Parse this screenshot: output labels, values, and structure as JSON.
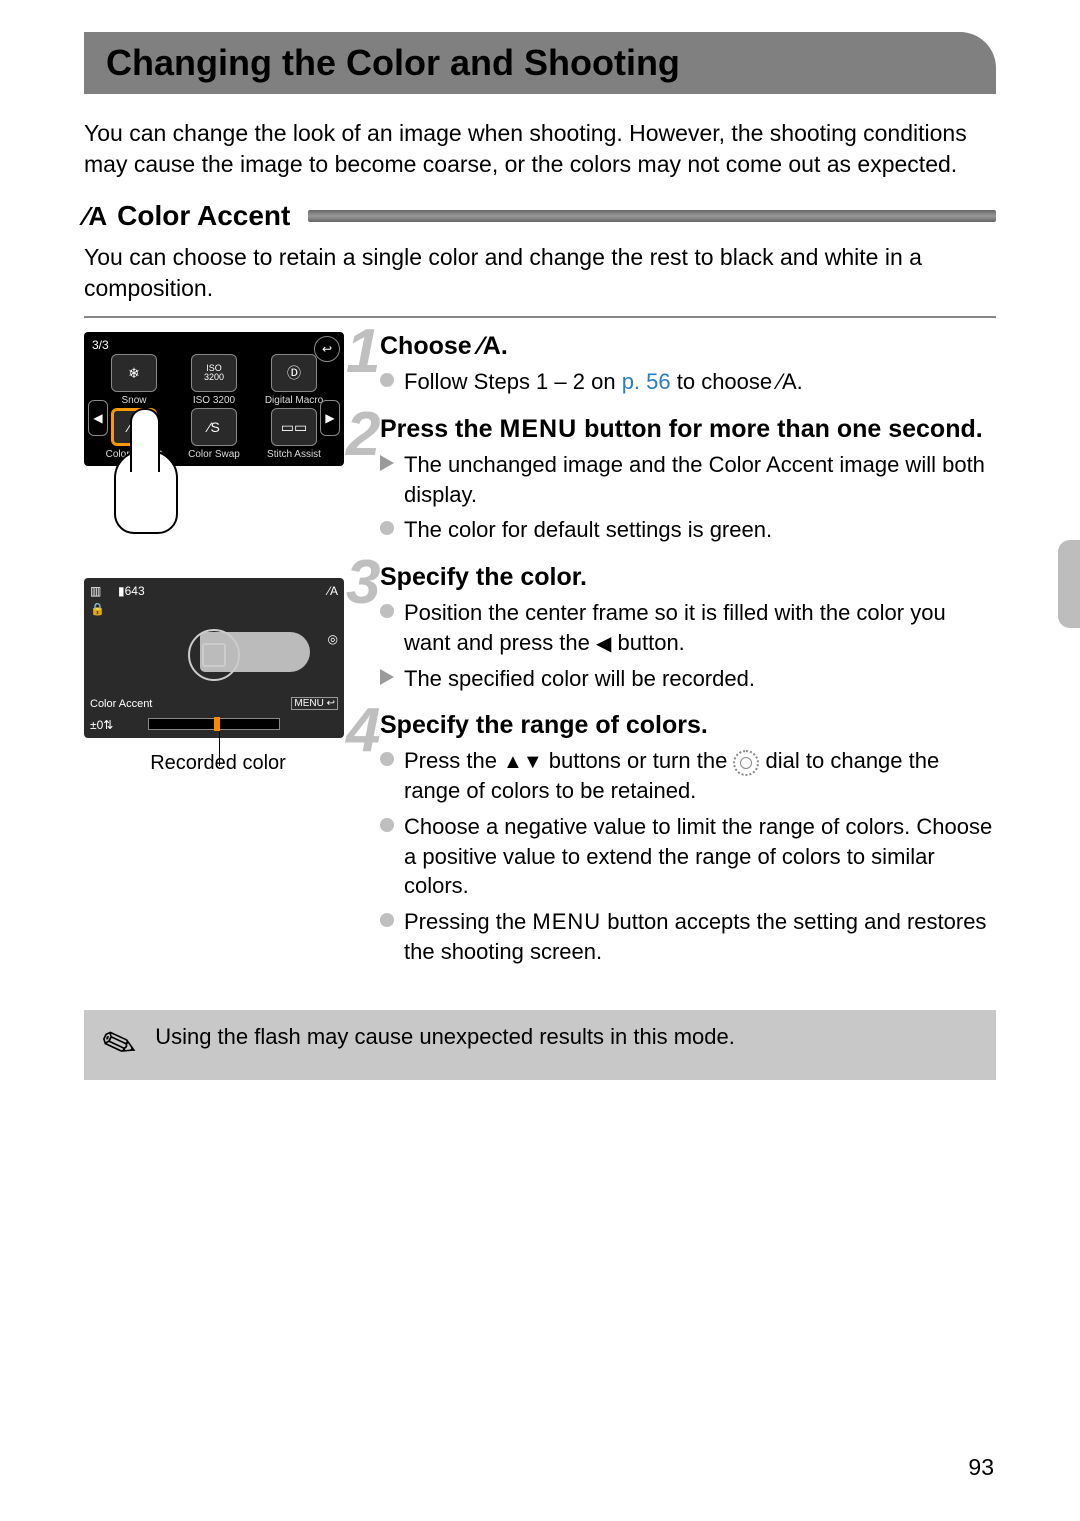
{
  "page": {
    "title": "Changing the Color and Shooting",
    "intro": "You can change the look of an image when shooting. However, the shooting conditions may cause the image to become coarse, or the colors may not come out as expected.",
    "number": "93"
  },
  "section": {
    "icon_label": "⁄A",
    "title": "Color Accent",
    "subtext": "You can choose to retain a single color and change the rest to black and white in a composition."
  },
  "camera_menu": {
    "counter": "3/3",
    "items": [
      {
        "icon": "❄",
        "label": "Snow"
      },
      {
        "icon": "ISO\n3200",
        "label": "ISO 3200"
      },
      {
        "icon": "Ⓓ",
        "label": "Digital Macro"
      },
      {
        "icon": "⁄A",
        "label": "Color Accent",
        "selected": true
      },
      {
        "icon": "⁄S",
        "label": "Color Swap"
      },
      {
        "icon": "▭▭",
        "label": "Stitch Assist"
      }
    ]
  },
  "preview_screen": {
    "mode_label": "Color Accent",
    "range": "±0",
    "shots": "643",
    "corner_icon": "⁄A",
    "menu_hint": "MENU ↩",
    "caption": "Recorded color"
  },
  "steps": [
    {
      "n": "1",
      "title_pre": "Choose ",
      "title_icon": "⁄A",
      "title_post": ".",
      "bullets": [
        {
          "type": "dot",
          "pre": "Follow Steps 1 – 2 on ",
          "link": "p. 56",
          "post": " to choose ",
          "icon": "⁄A",
          "tail": "."
        }
      ]
    },
    {
      "n": "2",
      "title_pre": "Press the ",
      "title_button": "MENU",
      "title_post": " button for more than one second.",
      "bullets": [
        {
          "type": "tri",
          "text": "The unchanged image and the Color Accent image will both display."
        },
        {
          "type": "dot",
          "text": "The color for default settings is green."
        }
      ]
    },
    {
      "n": "3",
      "title": "Specify the color.",
      "bullets": [
        {
          "type": "dot",
          "pre": "Position the center frame so it is filled with the color you want and press the ",
          "glyph": "◀",
          "post": " button."
        },
        {
          "type": "tri",
          "text": "The specified color will be recorded."
        }
      ]
    },
    {
      "n": "4",
      "title": "Specify the range of colors.",
      "bullets": [
        {
          "type": "dot",
          "pre": "Press the ",
          "glyph": "▲▼",
          "mid": " buttons or turn the ",
          "dial": true,
          "post": " dial to change the range of colors to be retained."
        },
        {
          "type": "dot",
          "text": "Choose a negative value to limit the range of colors. Choose a positive value to extend the range of colors to similar colors."
        },
        {
          "type": "dot",
          "pre": "Pressing the ",
          "button": "MENU",
          "post": " button accepts the setting and restores the shooting screen."
        }
      ]
    }
  ],
  "tip": "Using the flash may cause unexpected results in this mode."
}
